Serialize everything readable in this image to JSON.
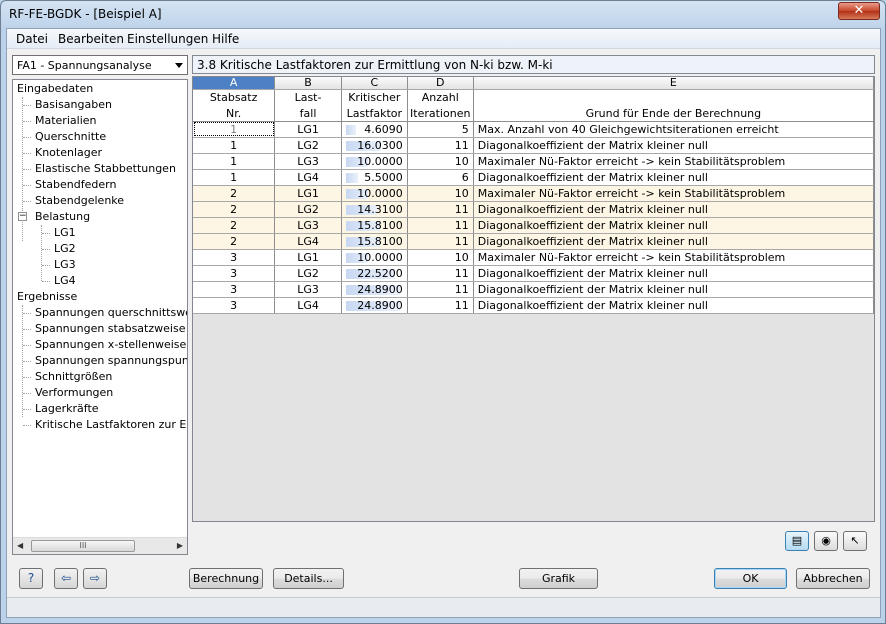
{
  "window": {
    "title": "RF-FE-BGDK - [Beispiel A]",
    "close_glyph": "✕"
  },
  "menu": [
    "Datei",
    "Bearbeiten",
    "Einstellungen",
    "Hilfe"
  ],
  "case_select": {
    "value": "FA1 - Spannungsanalyse"
  },
  "tree": {
    "input_root": "Eingabedaten",
    "input_items": [
      "Basisangaben",
      "Materialien",
      "Querschnitte",
      "Knotenlager",
      "Elastische Stabbettungen",
      "Stabendfedern",
      "Stabendgelenke"
    ],
    "loading": "Belastung",
    "loading_items": [
      "LG1",
      "LG2",
      "LG3",
      "LG4"
    ],
    "results_root": "Ergebnisse",
    "result_items": [
      "Spannungen querschnittsweise",
      "Spannungen stabsatzweise",
      "Spannungen x-stellenweise",
      "Spannungen spannungspunktweise",
      "Schnittgrößen",
      "Verformungen",
      "Lagerkräfte",
      "Kritische Lastfaktoren zur Ermittlung"
    ],
    "scroll_thumb": "III"
  },
  "heading": "3.8 Kritische Lastfaktoren zur Ermittlung von N-ki bzw. M-ki",
  "table": {
    "col_letters": [
      "A",
      "B",
      "C",
      "D",
      "E"
    ],
    "headers": [
      [
        "Stabsatz",
        "Last-",
        "Kritischer",
        "Anzahl",
        ""
      ],
      [
        "Nr.",
        "fall",
        "Lastfaktor",
        "Iterationen",
        "Grund für Ende der Berechnung"
      ]
    ],
    "rows": [
      {
        "stabsatz": "1",
        "lastfall": "LG1",
        "faktor": "4.6090",
        "fraction": 0.185,
        "iter": "5",
        "grund": "Max. Anzahl von 40 Gleichgewichtsiterationen erreicht"
      },
      {
        "stabsatz": "1",
        "lastfall": "LG2",
        "faktor": "16.0300",
        "fraction": 0.644,
        "iter": "11",
        "grund": "Diagonalkoeffizient der Matrix kleiner null"
      },
      {
        "stabsatz": "1",
        "lastfall": "LG3",
        "faktor": "10.0000",
        "fraction": 0.402,
        "iter": "10",
        "grund": "Maximaler Nü-Faktor erreicht -> kein Stabilitätsproblem"
      },
      {
        "stabsatz": "1",
        "lastfall": "LG4",
        "faktor": "5.5000",
        "fraction": 0.221,
        "iter": "6",
        "grund": "Diagonalkoeffizient der Matrix kleiner null"
      },
      {
        "stabsatz": "2",
        "lastfall": "LG1",
        "faktor": "10.0000",
        "fraction": 0.402,
        "iter": "10",
        "grund": "Maximaler Nü-Faktor erreicht -> kein Stabilitätsproblem"
      },
      {
        "stabsatz": "2",
        "lastfall": "LG2",
        "faktor": "14.3100",
        "fraction": 0.575,
        "iter": "11",
        "grund": "Diagonalkoeffizient der Matrix kleiner null"
      },
      {
        "stabsatz": "2",
        "lastfall": "LG3",
        "faktor": "15.8100",
        "fraction": 0.635,
        "iter": "11",
        "grund": "Diagonalkoeffizient der Matrix kleiner null"
      },
      {
        "stabsatz": "2",
        "lastfall": "LG4",
        "faktor": "15.8100",
        "fraction": 0.635,
        "iter": "11",
        "grund": "Diagonalkoeffizient der Matrix kleiner null"
      },
      {
        "stabsatz": "3",
        "lastfall": "LG1",
        "faktor": "10.0000",
        "fraction": 0.402,
        "iter": "10",
        "grund": "Maximaler Nü-Faktor erreicht -> kein Stabilitätsproblem"
      },
      {
        "stabsatz": "3",
        "lastfall": "LG2",
        "faktor": "22.5200",
        "fraction": 0.905,
        "iter": "11",
        "grund": "Diagonalkoeffizient der Matrix kleiner null"
      },
      {
        "stabsatz": "3",
        "lastfall": "LG3",
        "faktor": "24.8900",
        "fraction": 1.0,
        "iter": "11",
        "grund": "Diagonalkoeffizient der Matrix kleiner null"
      },
      {
        "stabsatz": "3",
        "lastfall": "LG4",
        "faktor": "24.8900",
        "fraction": 1.0,
        "iter": "11",
        "grund": "Diagonalkoeffizient der Matrix kleiner null"
      }
    ]
  },
  "buttons": {
    "berechnung": "Berechnung",
    "details": "Details...",
    "grafik": "Grafik",
    "ok": "OK",
    "abbrechen": "Abbrechen"
  },
  "icons": {
    "help": "help-icon",
    "import": "import-icon",
    "export": "export-icon",
    "table_view": "table-view-icon",
    "eye": "eye-icon",
    "select": "pick-icon"
  },
  "colors": {
    "selected_column": "#4d80c4",
    "alt_row": "#fdf6e4",
    "bar": "#c8d8f2"
  }
}
